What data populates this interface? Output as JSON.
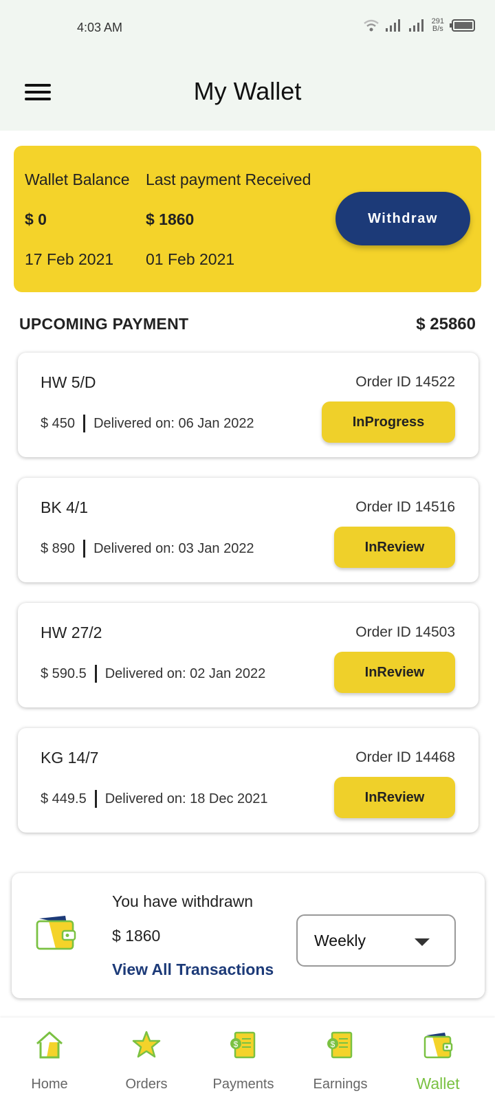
{
  "status_bar": {
    "time": "4:03 AM",
    "net_speed_top": "291",
    "net_speed_bottom": "B/s"
  },
  "header": {
    "title": "My Wallet"
  },
  "balance_card": {
    "wallet_balance_label": "Wallet Balance",
    "wallet_balance_amount": "$ 0",
    "wallet_balance_date": "17 Feb 2021",
    "last_payment_label": "Last payment Received",
    "last_payment_amount": "$ 1860",
    "last_payment_date": "01 Feb 2021",
    "withdraw_label": "Withdraw"
  },
  "upcoming": {
    "title": "UPCOMING PAYMENT",
    "total": "$ 25860",
    "orders": [
      {
        "code": "HW 5/D",
        "order_id": "Order ID 14522",
        "amount": "$ 450",
        "delivered": "Delivered on: 06 Jan 2022",
        "status": "InProgress"
      },
      {
        "code": "BK 4/1",
        "order_id": "Order ID 14516",
        "amount": "$ 890",
        "delivered": "Delivered on: 03 Jan 2022",
        "status": "InReview"
      },
      {
        "code": "HW 27/2",
        "order_id": "Order ID 14503",
        "amount": "$ 590.5",
        "delivered": "Delivered on: 02 Jan 2022",
        "status": "InReview"
      },
      {
        "code": "KG 14/7",
        "order_id": "Order ID 14468",
        "amount": "$ 449.5",
        "delivered": "Delivered on: 18 Dec 2021",
        "status": "InReview"
      }
    ]
  },
  "withdrawn": {
    "title": "You have withdrawn",
    "amount": "$ 1860",
    "link": "View All Transactions",
    "period": "Weekly"
  },
  "bottom_nav": {
    "items": [
      {
        "label": "Home",
        "icon": "home-icon"
      },
      {
        "label": "Orders",
        "icon": "star-icon"
      },
      {
        "label": "Payments",
        "icon": "payments-icon"
      },
      {
        "label": "Earnings",
        "icon": "earnings-icon"
      },
      {
        "label": "Wallet",
        "icon": "wallet-icon"
      }
    ],
    "active": "Wallet"
  },
  "colors": {
    "accent_yellow": "#f4d32a",
    "primary_navy": "#1c3a78",
    "active_green": "#7ac142"
  }
}
